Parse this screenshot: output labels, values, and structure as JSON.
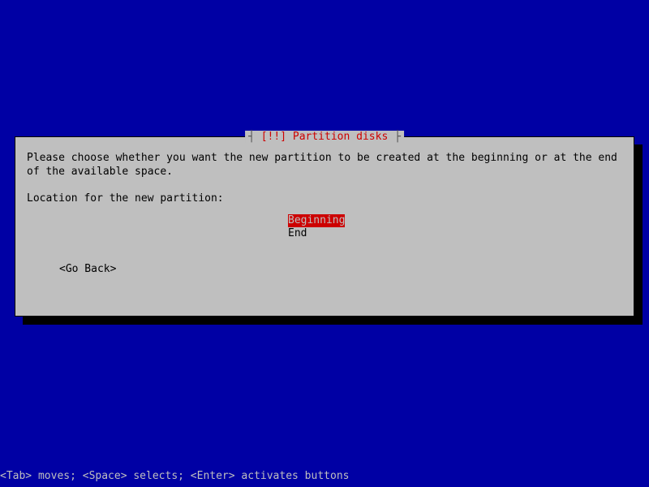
{
  "dialog": {
    "title_prefix": "[!!]",
    "title": "Partition disks",
    "instruction": "Please choose whether you want the new partition to be created at the beginning or at the end of the available space.",
    "prompt": "Location for the new partition:",
    "options": [
      {
        "label": "Beginning",
        "selected": true
      },
      {
        "label": "End",
        "selected": false
      }
    ],
    "go_back": "<Go Back>"
  },
  "footer": "<Tab> moves; <Space> selects; <Enter> activates buttons"
}
